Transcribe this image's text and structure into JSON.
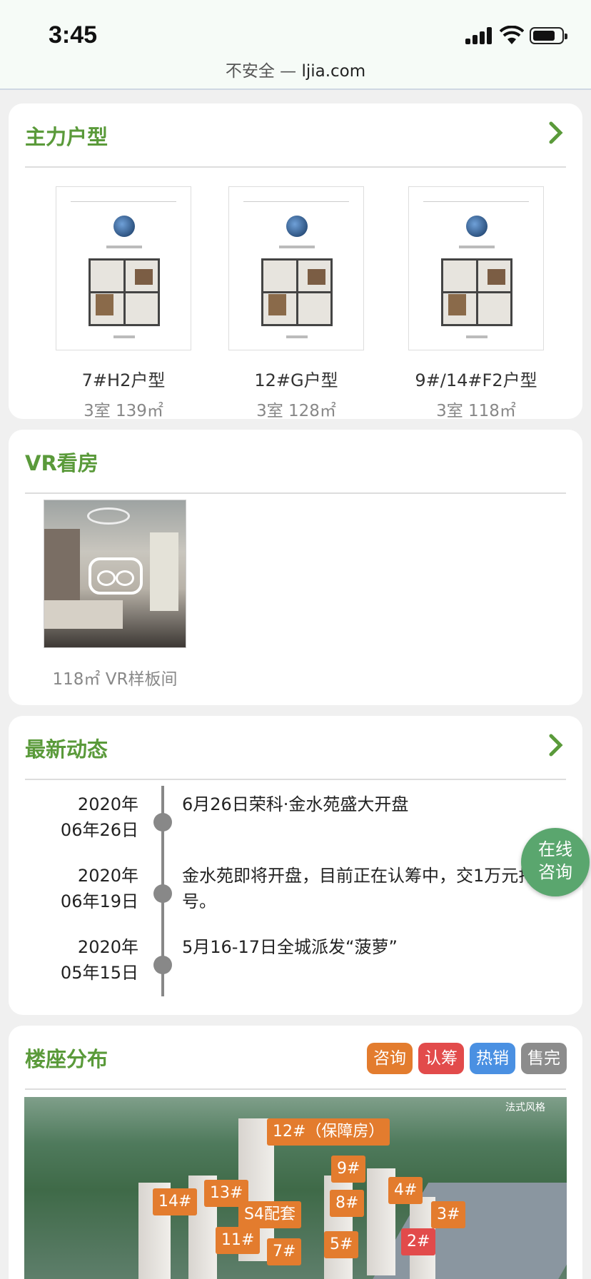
{
  "status_bar": {
    "time": "3:45",
    "url_prefix": "不安全 — ",
    "url_host": "ljia.com"
  },
  "floor_plans": {
    "title": "主力户型",
    "items": [
      {
        "name": "7#H2户型",
        "spec": "3室 139㎡"
      },
      {
        "name": "12#G户型",
        "spec": "3室 128㎡"
      },
      {
        "name": "9#/14#F2户型",
        "spec": "3室 118㎡"
      }
    ]
  },
  "vr": {
    "title": "VR看房",
    "caption": "118㎡ VR样板间"
  },
  "news": {
    "title": "最新动态",
    "items": [
      {
        "year": "2020年",
        "day": "06年26日",
        "text": "6月26日荣科·金水苑盛大开盘"
      },
      {
        "year": "2020年",
        "day": "06年19日",
        "text": "金水苑即将开盘，目前正在认筹中，交1万元排号。"
      },
      {
        "year": "2020年",
        "day": "05年15日",
        "text": "5月16-17日全城派发“菠萝”"
      }
    ]
  },
  "float_button": {
    "line1": "在线",
    "line2": "咨询"
  },
  "buildings": {
    "title": "楼座分布",
    "legend": [
      {
        "label": "咨询",
        "color": "#e37c2e"
      },
      {
        "label": "认筹",
        "color": "#e24b4b"
      },
      {
        "label": "热销",
        "color": "#4a90e2"
      },
      {
        "label": "售完",
        "color": "#8c8c8c"
      }
    ],
    "map_label": "法式风格",
    "tags": [
      "12#（保障房）",
      "9#",
      "4#",
      "14#",
      "13#",
      "8#",
      "3#",
      "S4配套",
      "11#",
      "5#",
      "2#",
      "7#"
    ]
  }
}
